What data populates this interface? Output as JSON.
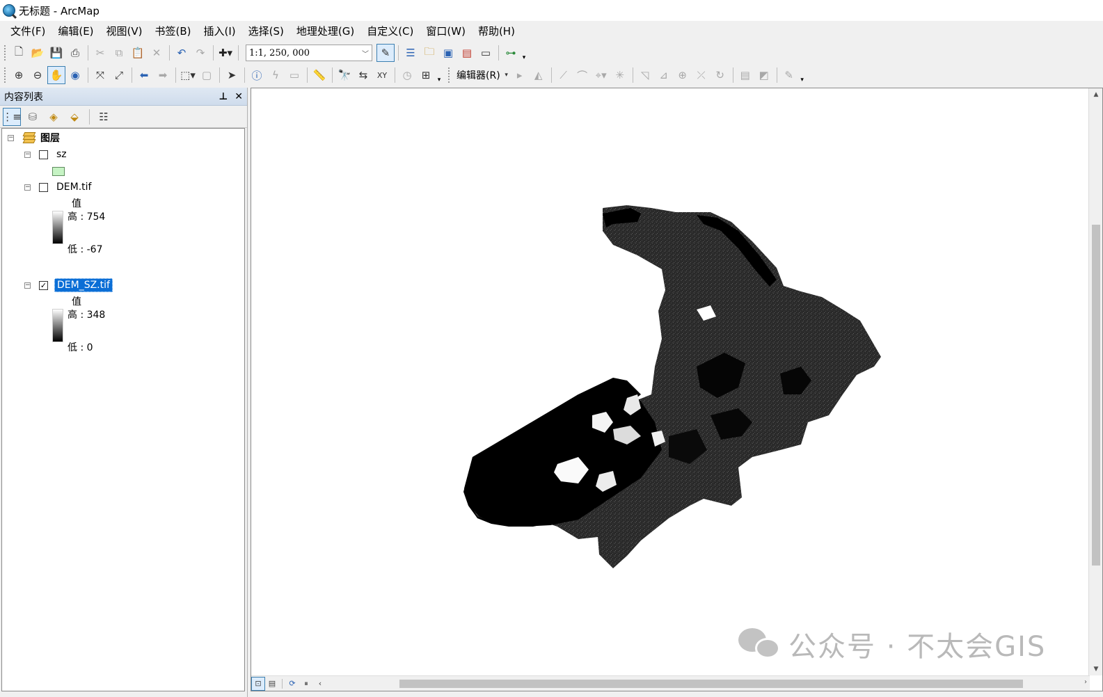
{
  "window": {
    "title": "无标题 - ArcMap"
  },
  "menu": [
    "文件(F)",
    "编辑(E)",
    "视图(V)",
    "书签(B)",
    "插入(I)",
    "选择(S)",
    "地理处理(G)",
    "自定义(C)",
    "窗口(W)",
    "帮助(H)"
  ],
  "toolbar": {
    "scale_value": "1:1, 250, 000",
    "editor_label": "编辑器(R)"
  },
  "toc": {
    "title": "内容列表",
    "root_label": "图层",
    "layers": [
      {
        "name": "sz",
        "checked": false,
        "type": "polygon",
        "fill": "#c6f3c4"
      },
      {
        "name": "DEM.tif",
        "checked": false,
        "type": "raster",
        "value_heading": "值",
        "high": "高 : 754",
        "low": "低 : -67"
      },
      {
        "name": "DEM_SZ.tif",
        "checked": true,
        "selected": true,
        "type": "raster",
        "value_heading": "值",
        "high": "高 : 348",
        "low": "低 : 0"
      }
    ]
  },
  "watermark": {
    "text": "公众号 · 不太会GIS"
  },
  "colors": {
    "selection": "#0a6ed6",
    "panel": "#f0f0f0",
    "polygon_fill": "#c6f3c4"
  }
}
